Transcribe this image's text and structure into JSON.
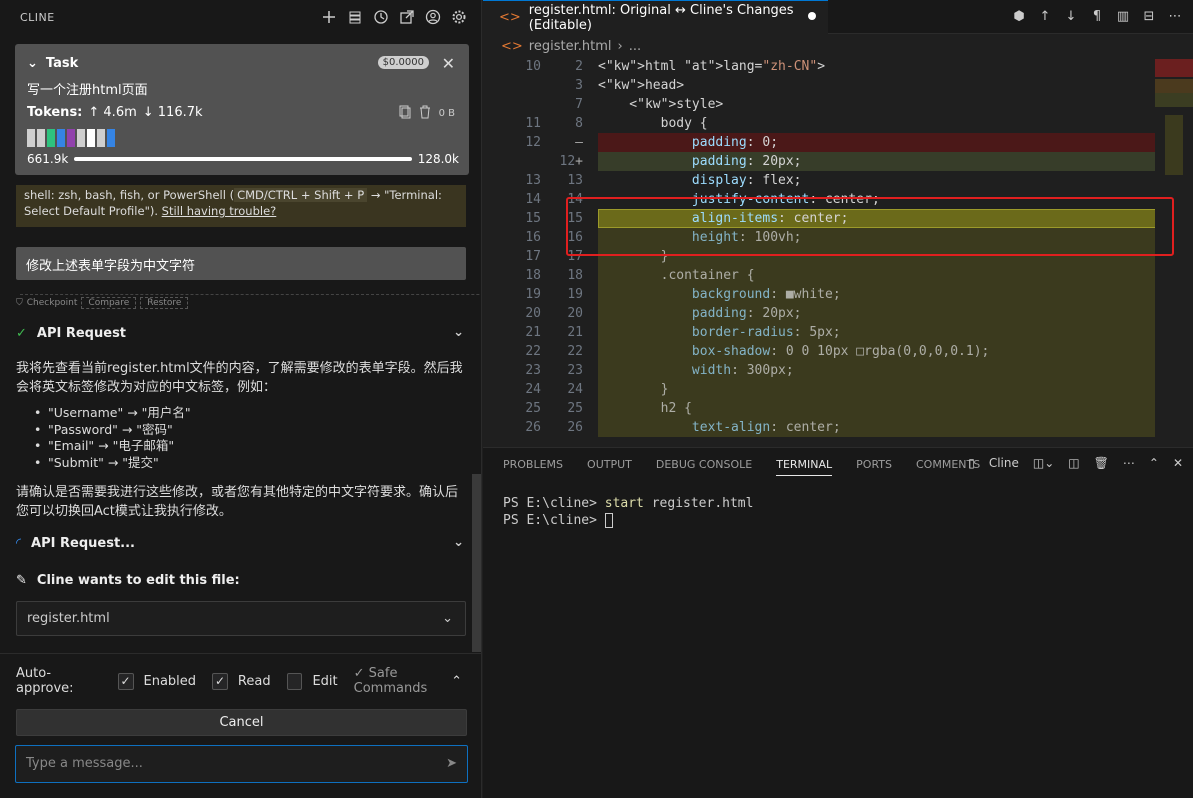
{
  "cline": {
    "title": "CLINE",
    "task": {
      "label": "Task",
      "cost": "$0.0000",
      "description": "写一个注册html页面",
      "tokens_label": "Tokens:",
      "tokens_up": "↑ 4.6m",
      "tokens_down": "↓ 116.7k",
      "size": "0 B",
      "context_used": "661.9k",
      "context_max": "128.0k",
      "context_fill": 1.0
    },
    "notice": {
      "text_before": "shell: zsh, bash, fish, or PowerShell (",
      "kbd": "CMD/CTRL + Shift + P",
      "text_after": " → \"Terminal: Select Default Profile\"). ",
      "link": "Still having trouble?"
    },
    "user_message": "修改上述表单字段为中文字符",
    "checkpoint": {
      "label": "Checkpoint",
      "compare": "Compare",
      "restore": "Restore"
    },
    "api_request_1": "API Request",
    "response_para": "我将先查看当前register.html文件的内容，了解需要修改的表单字段。然后我会将英文标签修改为对应的中文标签，例如：",
    "bullets": [
      "\"Username\" → \"用户名\"",
      "\"Password\" → \"密码\"",
      "\"Email\" → \"电子邮箱\"",
      "\"Submit\" → \"提交\""
    ],
    "confirm_para": "请确认是否需要我进行这些修改，或者您有其他特定的中文字符要求。确认后您可以切换回Act模式让我执行修改。",
    "api_request_2": "API Request...",
    "edit_label": "Cline wants to edit this file:",
    "file_name": "register.html",
    "auto_approve": {
      "label": "Auto-approve:",
      "enabled": "Enabled",
      "read": "Read",
      "edit": "Edit",
      "safe": "✓ Safe Commands"
    },
    "cancel": "Cancel",
    "input_placeholder": "Type a message..."
  },
  "editor": {
    "tab_title": "register.html: Original ↔ Cline's Changes (Editable)",
    "breadcrumb_file": "register.html",
    "breadcrumb_rest": "...",
    "lines": [
      {
        "l": "10",
        "r": "2",
        "mk": "",
        "code": "<html lang=\"zh-CN\">",
        "bg": ""
      },
      {
        "l": "",
        "r": "3",
        "mk": "",
        "code": "<head>",
        "bg": ""
      },
      {
        "l": "",
        "r": "7",
        "mk": "",
        "code": "    <style>",
        "bg": ""
      },
      {
        "l": "11",
        "r": "8",
        "mk": "",
        "code": "        body {",
        "bg": ""
      },
      {
        "l": "12",
        "r": "",
        "mk": "—",
        "code": "            padding: 0;",
        "bg": "del"
      },
      {
        "l": "",
        "r": "12",
        "mk": "+",
        "code": "            padding: 20px;",
        "bg": "add"
      },
      {
        "l": "13",
        "r": "13",
        "mk": "",
        "code": "            display: flex;",
        "bg": ""
      },
      {
        "l": "14",
        "r": "14",
        "mk": "",
        "code": "            justify-content: center;",
        "bg": ""
      },
      {
        "l": "15",
        "r": "15",
        "mk": "",
        "code": "            align-items: center;",
        "bg": "hl"
      },
      {
        "l": "16",
        "r": "16",
        "mk": "",
        "code": "            height: 100vh;",
        "bg": "dim"
      },
      {
        "l": "17",
        "r": "17",
        "mk": "",
        "code": "        }",
        "bg": "dim"
      },
      {
        "l": "18",
        "r": "18",
        "mk": "",
        "code": "        .container {",
        "bg": "dim"
      },
      {
        "l": "19",
        "r": "19",
        "mk": "",
        "code": "            background: ■white;",
        "bg": "dim"
      },
      {
        "l": "20",
        "r": "20",
        "mk": "",
        "code": "            padding: 20px;",
        "bg": "dim"
      },
      {
        "l": "21",
        "r": "21",
        "mk": "",
        "code": "            border-radius: 5px;",
        "bg": "dim"
      },
      {
        "l": "22",
        "r": "22",
        "mk": "",
        "code": "            box-shadow: 0 0 10px □rgba(0,0,0,0.1);",
        "bg": "dim"
      },
      {
        "l": "23",
        "r": "23",
        "mk": "",
        "code": "            width: 300px;",
        "bg": "dim"
      },
      {
        "l": "24",
        "r": "24",
        "mk": "",
        "code": "        }",
        "bg": "dim"
      },
      {
        "l": "25",
        "r": "25",
        "mk": "",
        "code": "        h2 {",
        "bg": "dim"
      },
      {
        "l": "26",
        "r": "26",
        "mk": "",
        "code": "            text-align: center;",
        "bg": "dim"
      }
    ]
  },
  "panel": {
    "tabs": [
      "PROBLEMS",
      "OUTPUT",
      "DEBUG CONSOLE",
      "TERMINAL",
      "PORTS",
      "COMMENTS"
    ],
    "active_tab": "TERMINAL",
    "terminal_name": "Cline",
    "terminal": {
      "prompt1": "PS E:\\cline> ",
      "cmd1": "start",
      "arg1": " register.html",
      "prompt2": "PS E:\\cline> "
    }
  },
  "colors": {
    "accent": "#0078d4",
    "diff_removed": "#4b1818",
    "diff_added": "#373d29",
    "diff_dim": "#3b3a1e",
    "highlight": "#6b6a1a",
    "annotation_box": "#e01f1f"
  }
}
